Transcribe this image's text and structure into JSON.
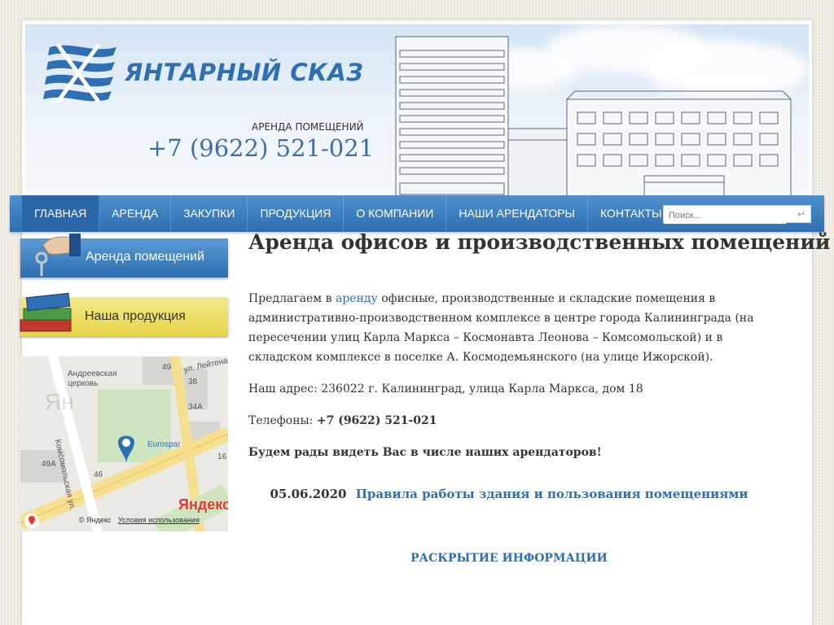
{
  "header": {
    "logo_text": "ЯНТАРНЫЙ СКАЗ",
    "rent_label": "АРЕНДА ПОМЕЩЕНИЙ",
    "phone": "+7 (9622) 521-021"
  },
  "nav": {
    "items": [
      {
        "label": "ГЛАВНАЯ",
        "active": true
      },
      {
        "label": "АРЕНДА"
      },
      {
        "label": "ЗАКУПКИ"
      },
      {
        "label": "ПРОДУКЦИЯ"
      },
      {
        "label": "О КОМПАНИИ"
      },
      {
        "label": "НАШИ АРЕНДАТОРЫ"
      },
      {
        "label": "КОНТАКТЫ"
      }
    ],
    "search_placeholder": "Поиск..."
  },
  "sidebar": {
    "banner_rent": "Аренда помещений",
    "banner_products": "Наша продукция",
    "map": {
      "labels": [
        "ул. Лейтенанта",
        "Андреевская церковь",
        "Eurospar",
        "Комсомольская ул.",
        "49",
        "38",
        "34А",
        "46",
        "49А",
        "16",
        "Ян"
      ],
      "logo": "Яндекс",
      "copyright": "© Яндекс",
      "terms": "Условия использования"
    }
  },
  "main": {
    "title": "Аренда офисов и производственных помещений",
    "intro_before": "Предлагаем в ",
    "intro_link": "аренду",
    "intro_after": " офисные, производственные и складские помещения в административно-производственном комплексе в центре города Калининграда (на пересечении улиц Карла Маркса – Космонавта Леонова – Комсомольской) и в складском комплексе в поселке А. Космодемьянского (на улице Ижорской).",
    "address": "Наш адрес: 236022 г. Калининград, улица Карла Маркса, дом 18",
    "phones_label": "Телефоны: ",
    "phones_value": "+7 (9622) 521-021",
    "welcome": "Будем рады видеть Вас в числе наших арендаторов!",
    "news_date": "05.06.2020",
    "news_link": "Правила работы здания и пользования помещениями",
    "disclosure": "РАСКРЫТИЕ ИНФОРМАЦИИ"
  },
  "colors": {
    "brand_blue": "#2f6fb3",
    "nav_blue": "#2d6fb0",
    "banner_yellow": "#e6d548"
  }
}
